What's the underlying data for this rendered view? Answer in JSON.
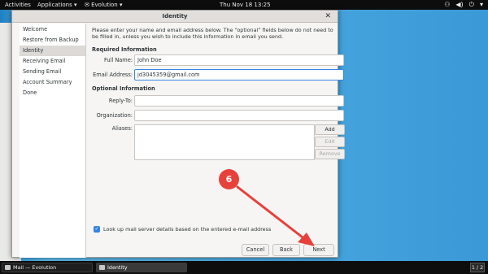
{
  "top_bar": {
    "activities": "Activities",
    "applications": "Applications ▾",
    "app_name": "Evolution ▾",
    "clock": "Thu Nov 18  13:25"
  },
  "dialog": {
    "title": "Identity",
    "sidebar": [
      {
        "label": "Welcome"
      },
      {
        "label": "Restore from Backup"
      },
      {
        "label": "Identity"
      },
      {
        "label": "Receiving Email"
      },
      {
        "label": "Sending Email"
      },
      {
        "label": "Account Summary"
      },
      {
        "label": "Done"
      }
    ],
    "intro": "Please enter your name and email address below. The “optional” fields below do not need to be filled in, unless you wish to include this information in email you send.",
    "required_heading": "Required Information",
    "optional_heading": "Optional Information",
    "fields": {
      "full_name": {
        "label": "Full Name:",
        "value": "John Doe"
      },
      "email": {
        "label": "Email Address:",
        "value": "jd3045359@gmail.com"
      },
      "reply_to": {
        "label": "Reply-To:",
        "value": ""
      },
      "organization": {
        "label": "Organization:",
        "value": ""
      },
      "aliases": {
        "label": "Aliases:"
      }
    },
    "alias_buttons": {
      "add": "Add",
      "edit": "Edit",
      "remove": "Remove"
    },
    "lookup_checkbox": {
      "label": "Look up mail server details based on the entered e-mail address",
      "checked": true
    },
    "buttons": {
      "cancel": "Cancel",
      "back": "Back",
      "next": "Next"
    }
  },
  "annotation": {
    "step": "6",
    "color": "#e8403b"
  },
  "taskbar": {
    "items": [
      {
        "label": "Mail — Evolution"
      },
      {
        "label": "Identity"
      }
    ],
    "workspace": "1 / 2"
  },
  "colors": {
    "accent": "#3584e4",
    "annotation": "#e8403b"
  }
}
